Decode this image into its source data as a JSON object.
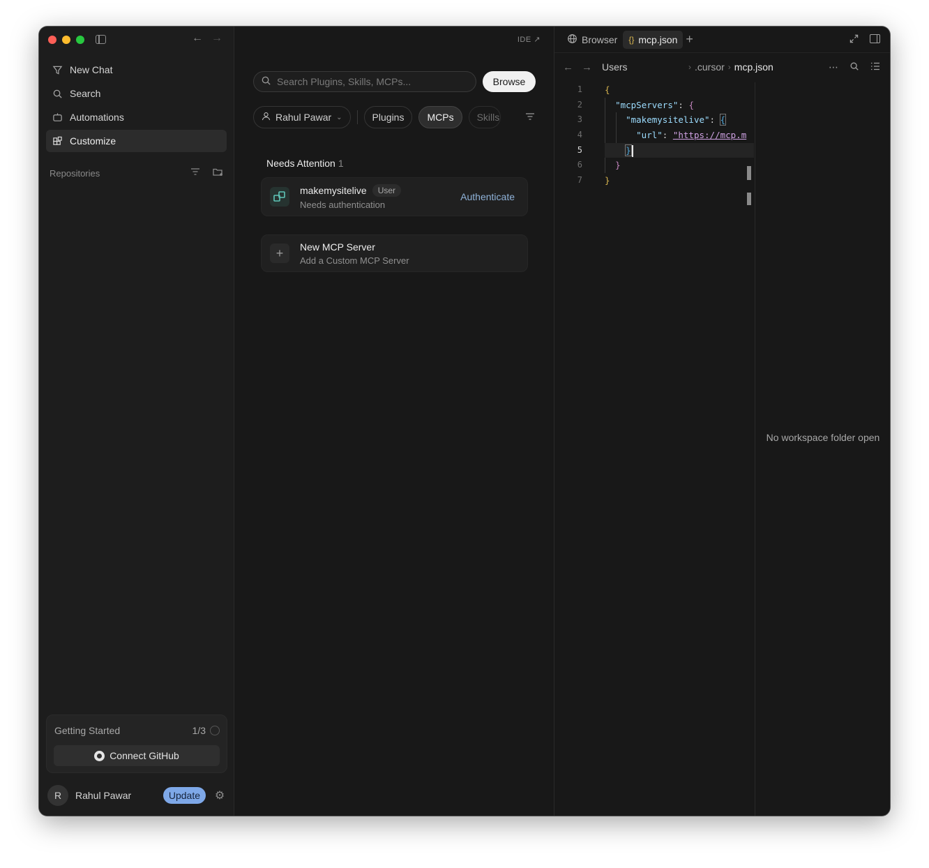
{
  "sidebar": {
    "menu": [
      {
        "label": "New Chat",
        "icon": "new-chat-icon"
      },
      {
        "label": "Search",
        "icon": "search-icon"
      },
      {
        "label": "Automations",
        "icon": "automations-icon"
      },
      {
        "label": "Customize",
        "icon": "customize-icon",
        "active": true
      }
    ],
    "repositories_label": "Repositories",
    "getting_started": {
      "label": "Getting Started",
      "progress": "1/3"
    },
    "connect_github_label": "Connect GitHub",
    "user": {
      "initial": "R",
      "name": "Rahul Pawar"
    },
    "update_label": "Update"
  },
  "middle": {
    "ide_label": "IDE ↗",
    "search_placeholder": "Search Plugins, Skills, MCPs...",
    "browse_label": "Browse",
    "chips": {
      "user": "Rahul Pawar",
      "plugins": "Plugins",
      "mcps": "MCPs",
      "skills": "Skills"
    },
    "needs_attention": {
      "title": "Needs Attention",
      "count": "1"
    },
    "mcp_item": {
      "name": "makemysitelive",
      "badge": "User",
      "status": "Needs authentication",
      "action": "Authenticate"
    },
    "new_server": {
      "title": "New MCP Server",
      "subtitle": "Add a Custom MCP Server"
    }
  },
  "right": {
    "tabs": {
      "browser": "Browser",
      "file": "mcp.json"
    },
    "breadcrumb": {
      "root": "Users",
      "folder": ".cursor",
      "file": "mcp.json"
    },
    "line_numbers": [
      "1",
      "2",
      "3",
      "4",
      "5",
      "6",
      "7"
    ],
    "code": {
      "open_brace": "{",
      "key_mcp_servers": "\"mcpServers\"",
      "key_site": "\"makemysitelive\"",
      "key_url": "\"url\"",
      "url_value": "\"https://mcp.m",
      "colon": ": ",
      "close_brace": "}"
    },
    "empty_message": "No workspace folder open"
  },
  "colors": {
    "accent_update": "#7ea8e8",
    "authenticate_link": "#8fb2d8",
    "traffic_red": "#fe5f57",
    "traffic_yellow": "#febc2e",
    "traffic_green": "#28c840"
  }
}
